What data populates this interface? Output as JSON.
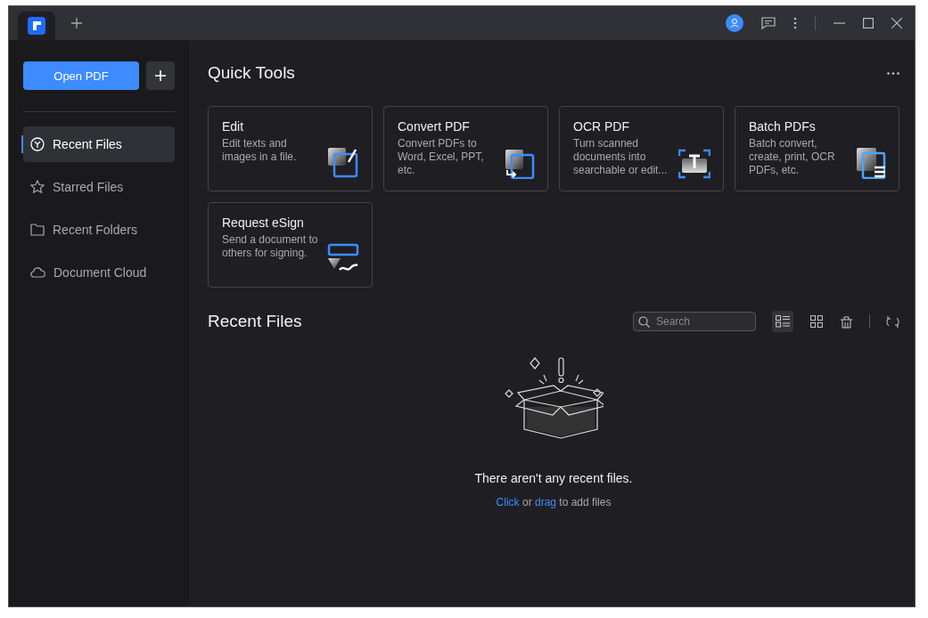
{
  "tab": {
    "selected": true
  },
  "sidebar": {
    "open_button": "Open PDF",
    "items": [
      {
        "label": "Recent Files",
        "kind": "recent",
        "selected": true
      },
      {
        "label": "Starred Files",
        "kind": "starred",
        "selected": false
      },
      {
        "label": "Recent Folders",
        "kind": "folders",
        "selected": false
      },
      {
        "label": "Document Cloud",
        "kind": "cloud",
        "selected": false
      }
    ]
  },
  "quick_tools": {
    "title": "Quick Tools",
    "tools": [
      {
        "kind": "edit",
        "title": "Edit",
        "description": "Edit texts and images in a file."
      },
      {
        "kind": "convert",
        "title": "Convert PDF",
        "description": "Convert PDFs to Word, Excel, PPT, etc."
      },
      {
        "kind": "ocr",
        "title": "OCR PDF",
        "description": "Turn scanned documents into searchable or edit..."
      },
      {
        "kind": "batch",
        "title": "Batch PDFs",
        "description": "Batch convert, create, print, OCR PDFs, etc."
      },
      {
        "kind": "esign",
        "title": "Request eSign",
        "description": "Send a document to others for signing."
      }
    ]
  },
  "recent": {
    "title": "Recent Files",
    "search": {
      "placeholder": "Search"
    },
    "views": [
      {
        "kind": "list",
        "selected": true
      },
      {
        "kind": "grid",
        "selected": false
      }
    ],
    "empty_message": "There aren't any recent files.",
    "hint": {
      "link1": "Click",
      "between": "or",
      "link2": "drag",
      "after": "to add files"
    }
  }
}
